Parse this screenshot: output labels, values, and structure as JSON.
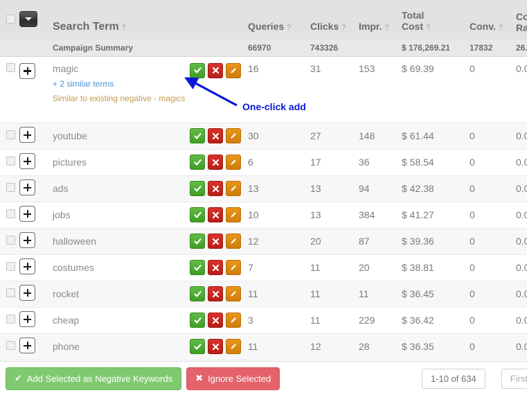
{
  "table": {
    "columns": [
      {
        "key": "checkbox",
        "label": ""
      },
      {
        "key": "expand",
        "label": ""
      },
      {
        "key": "term",
        "label": "Search Term",
        "help": "?"
      },
      {
        "key": "actions",
        "label": ""
      },
      {
        "key": "queries",
        "label": "Queries",
        "help": "?"
      },
      {
        "key": "clicks",
        "label": "Clicks",
        "help": "?"
      },
      {
        "key": "impr",
        "label": "Impr.",
        "help": "?"
      },
      {
        "key": "cost",
        "label_line1": "Total",
        "label_line2": "Cost",
        "help": "?"
      },
      {
        "key": "conv",
        "label": "Conv.",
        "help": "?"
      },
      {
        "key": "conv_rate",
        "label_line1": "Co",
        "label_line2": "Ra",
        "help": ""
      }
    ],
    "summary": {
      "label": "Campaign Summary",
      "queries": "66970",
      "clicks": "743326",
      "impr": "",
      "cost": "$ 176,269.21",
      "conv": "17832",
      "conv_rate": "26."
    },
    "rows": [
      {
        "term": "magic",
        "similar_link": "+ 2 similar terms",
        "note": "Similar to existing negative - magics",
        "queries": "16",
        "clicks": "31",
        "impr": "153",
        "cost": "$ 69.39",
        "conv": "0",
        "conv_rate": "0.0"
      },
      {
        "term": "youtube",
        "queries": "30",
        "clicks": "27",
        "impr": "148",
        "cost": "$ 61.44",
        "conv": "0",
        "conv_rate": "0.0"
      },
      {
        "term": "pictures",
        "queries": "6",
        "clicks": "17",
        "impr": "36",
        "cost": "$ 58.54",
        "conv": "0",
        "conv_rate": "0.0"
      },
      {
        "term": "ads",
        "queries": "13",
        "clicks": "13",
        "impr": "94",
        "cost": "$ 42.38",
        "conv": "0",
        "conv_rate": "0.0"
      },
      {
        "term": "jobs",
        "queries": "10",
        "clicks": "13",
        "impr": "384",
        "cost": "$ 41.27",
        "conv": "0",
        "conv_rate": "0.0"
      },
      {
        "term": "halloween",
        "queries": "12",
        "clicks": "20",
        "impr": "87",
        "cost": "$ 39.36",
        "conv": "0",
        "conv_rate": "0.0"
      },
      {
        "term": "costumes",
        "queries": "7",
        "clicks": "11",
        "impr": "20",
        "cost": "$ 38.81",
        "conv": "0",
        "conv_rate": "0.0"
      },
      {
        "term": "rocket",
        "queries": "11",
        "clicks": "11",
        "impr": "11",
        "cost": "$ 36.45",
        "conv": "0",
        "conv_rate": "0.0"
      },
      {
        "term": "cheap",
        "queries": "3",
        "clicks": "11",
        "impr": "229",
        "cost": "$ 36.42",
        "conv": "0",
        "conv_rate": "0.0"
      },
      {
        "term": "phone",
        "queries": "11",
        "clicks": "12",
        "impr": "28",
        "cost": "$ 36.35",
        "conv": "0",
        "conv_rate": "0.0"
      }
    ],
    "row_actions": {
      "approve_icon": "check-icon",
      "reject_icon": "cross-icon",
      "edit_icon": "pencil-icon"
    }
  },
  "toolbar": {
    "add_negative_label": "Add Selected as Negative Keywords",
    "add_negative_icon": "check-icon",
    "ignore_label": "Ignore Selected",
    "ignore_icon": "cross-icon",
    "page_count": "1-10 of 634",
    "first_label": "First"
  },
  "annotation": {
    "text": "One-click add",
    "color": "#0a17d8"
  },
  "colors": {
    "accent_green": "#81c971",
    "accent_red": "#e4636a",
    "accent_orange": "#e8971a",
    "link_blue": "#4a8fd0",
    "note_gold": "#c39a4a",
    "header_bg": "#e2e2e0"
  }
}
